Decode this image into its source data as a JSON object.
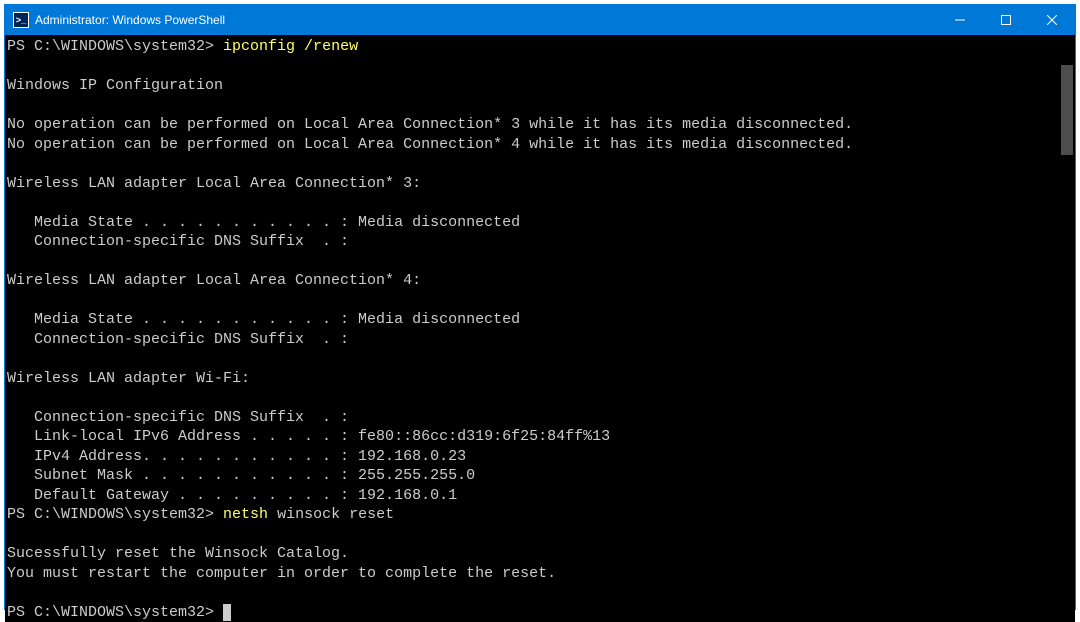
{
  "window": {
    "title": "Administrator: Windows PowerShell",
    "icon_glyph": ">_"
  },
  "terminal": {
    "prompt1": "PS C:\\WINDOWS\\system32> ",
    "cmd1": "ipconfig /renew",
    "blank": "",
    "hdr": "Windows IP Configuration",
    "noop3": "No operation can be performed on Local Area Connection* 3 while it has its media disconnected.",
    "noop4": "No operation can be performed on Local Area Connection* 4 while it has its media disconnected.",
    "adapter3_title": "Wireless LAN adapter Local Area Connection* 3:",
    "media_state_line": "   Media State . . . . . . . . . . . : Media disconnected",
    "dns_suffix_line": "   Connection-specific DNS Suffix  . :",
    "adapter4_title": "Wireless LAN adapter Local Area Connection* 4:",
    "wifi_title": "Wireless LAN adapter Wi-Fi:",
    "wifi_dns": "   Connection-specific DNS Suffix  . :",
    "wifi_ipv6": "   Link-local IPv6 Address . . . . . : fe80::86cc:d319:6f25:84ff%13",
    "wifi_ipv4": "   IPv4 Address. . . . . . . . . . . : 192.168.0.23",
    "wifi_mask": "   Subnet Mask . . . . . . . . . . . : 255.255.255.0",
    "wifi_gw": "   Default Gateway . . . . . . . . . : 192.168.0.1",
    "prompt2": "PS C:\\WINDOWS\\system32> ",
    "cmd2a": "netsh ",
    "cmd2b": "winsock reset",
    "reset_ok": "Sucessfully reset the Winsock Catalog.",
    "reset_restart": "You must restart the computer in order to complete the reset.",
    "prompt3": "PS C:\\WINDOWS\\system32> "
  }
}
